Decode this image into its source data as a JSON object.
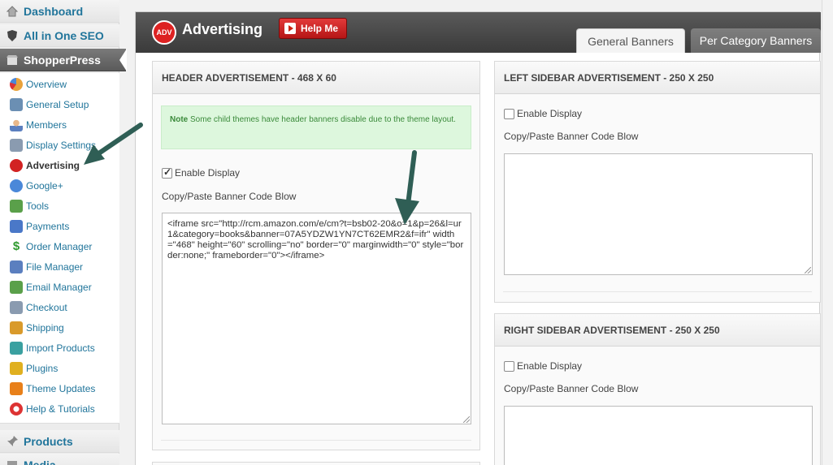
{
  "sidebar": {
    "top": [
      {
        "label": "Dashboard",
        "icon": "house-icon"
      },
      {
        "label": "All in One SEO",
        "icon": "shield-icon"
      },
      {
        "label": "ShopperPress",
        "icon": "shop-icon"
      }
    ],
    "items": [
      {
        "label": "Overview",
        "icon": "pie-chart-icon",
        "color": "#e9a23b"
      },
      {
        "label": "General Setup",
        "icon": "tools-icon",
        "color": "#6b8fb3"
      },
      {
        "label": "Members",
        "icon": "user-icon",
        "color": "#5b7fbf"
      },
      {
        "label": "Display Settings",
        "icon": "display-icon",
        "color": "#8a9bb0"
      },
      {
        "label": "Advertising",
        "icon": "adv-icon",
        "color": "#d22222"
      },
      {
        "label": "Google+",
        "icon": "google-icon",
        "color": "#4a88d9"
      },
      {
        "label": "Tools",
        "icon": "toolbox-icon",
        "color": "#5aa04a"
      },
      {
        "label": "Payments",
        "icon": "payments-icon",
        "color": "#4a78c8"
      },
      {
        "label": "Order Manager",
        "icon": "dollar-icon",
        "color": "#2f9a2f"
      },
      {
        "label": "File Manager",
        "icon": "file-icon",
        "color": "#5b7fbf"
      },
      {
        "label": "Email Manager",
        "icon": "email-icon",
        "color": "#5aa04a"
      },
      {
        "label": "Checkout",
        "icon": "basket-icon",
        "color": "#8a9bb0"
      },
      {
        "label": "Shipping",
        "icon": "box-icon",
        "color": "#d99a2b"
      },
      {
        "label": "Import Products",
        "icon": "import-icon",
        "color": "#3aa0a0"
      },
      {
        "label": "Plugins",
        "icon": "puzzle-icon",
        "color": "#e0b020"
      },
      {
        "label": "Theme Updates",
        "icon": "rss-icon",
        "color": "#e8801a"
      },
      {
        "label": "Help & Tutorials",
        "icon": "lifebuoy-icon",
        "color": "#d33"
      }
    ],
    "bottom": [
      {
        "label": "Products",
        "icon": "pin-icon"
      },
      {
        "label": "Media",
        "icon": "media-icon"
      }
    ]
  },
  "header": {
    "logo_text": "ADV",
    "title": "Advertising",
    "help_label": "Help Me",
    "tabs": [
      "General Banners",
      "Per Category Banners"
    ]
  },
  "header_ad": {
    "title": "HEADER ADVERTISEMENT - 468 X 60",
    "note_bold": "Note",
    "note_text": "Some child themes have header banners disable due to the theme layout.",
    "enable_label": "Enable Display",
    "enabled": true,
    "code_label": "Copy/Paste Banner Code Blow",
    "code_value": "<iframe src=\"http://rcm.amazon.com/e/cm?t=bsb02-20&o=1&p=26&l=ur1&category=books&banner=07A5YDZW1YN7CT62EMR2&f=ifr\" width=\"468\" height=\"60\" scrolling=\"no\" border=\"0\" marginwidth=\"0\" style=\"border:none;\" frameborder=\"0\"></iframe>"
  },
  "left_ad": {
    "title": "LEFT SIDEBAR ADVERTISEMENT - 250 X 250",
    "enable_label": "Enable Display",
    "enabled": false,
    "code_label": "Copy/Paste Banner Code Blow"
  },
  "right_ad": {
    "title": "RIGHT SIDEBAR ADVERTISEMENT - 250 X 250",
    "enable_label": "Enable Display",
    "enabled": false,
    "code_label": "Copy/Paste Banner Code Blow"
  }
}
